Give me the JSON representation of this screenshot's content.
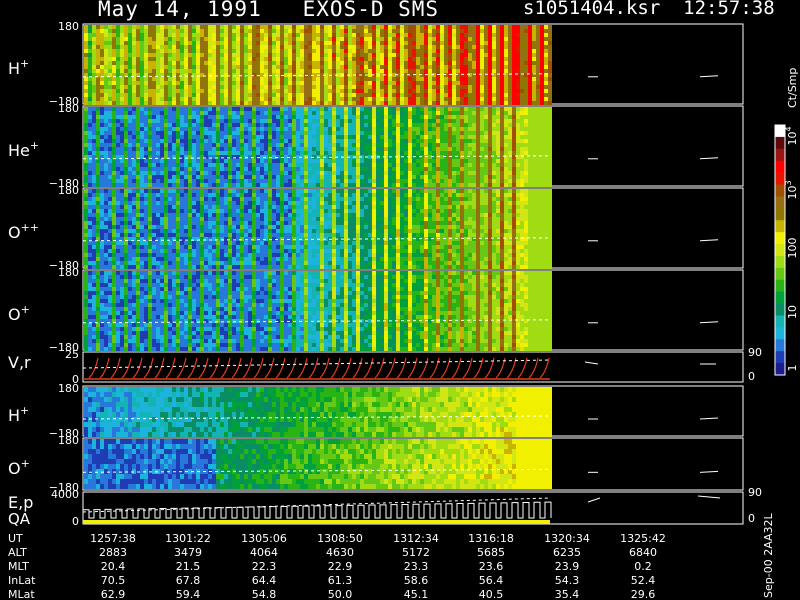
{
  "header": {
    "title": "May 14, 1991   EXOS-D SMS",
    "file_time": "s1051404.ksr  12:57:38"
  },
  "chart_data": {
    "type": "heatmap",
    "panels": [
      {
        "id": "h",
        "label_base": "H",
        "label_sup": "+",
        "y_top": "180",
        "y_bottom": "−180",
        "right_top": "",
        "right_bottom": ""
      },
      {
        "id": "he",
        "label_base": "He",
        "label_sup": "+",
        "y_top": "180",
        "y_bottom": "−180",
        "right_top": "",
        "right_bottom": ""
      },
      {
        "id": "opp",
        "label_base": "O",
        "label_sup": "++",
        "y_top": "180",
        "y_bottom": "−180",
        "right_top": "",
        "right_bottom": ""
      },
      {
        "id": "op",
        "label_base": "O",
        "label_sup": "+",
        "y_top": "180",
        "y_bottom": "−180",
        "right_top": "",
        "right_bottom": ""
      },
      {
        "id": "vr",
        "label_base": "V,r",
        "label_sup": "",
        "y_top": "25",
        "y_bottom": "0",
        "right_top": "90",
        "right_bottom": "0"
      },
      {
        "id": "h2",
        "label_base": "H",
        "label_sup": "+",
        "y_top": "180",
        "y_bottom": "−180",
        "right_top": "",
        "right_bottom": ""
      },
      {
        "id": "o2",
        "label_base": "O",
        "label_sup": "+",
        "y_top": "180",
        "y_bottom": "−180",
        "right_top": "",
        "right_bottom": ""
      },
      {
        "id": "ep",
        "label_base": "E,p",
        "label_sup": "",
        "y_top": "4000",
        "y_bottom": "0",
        "right_top": "90",
        "right_bottom": "0",
        "label2": "QA"
      }
    ],
    "colorbar": {
      "unit": "Ct/Smp",
      "tick_labels": [
        "1",
        "10",
        "100",
        "10",
        "10"
      ],
      "tick_exps": [
        "",
        "",
        "",
        "3",
        "4"
      ],
      "colors": [
        "#1c1c8c",
        "#1e3cb4",
        "#2878dc",
        "#1cb4dc",
        "#14b4b4",
        "#0a8c64",
        "#00a03c",
        "#28b414",
        "#64c814",
        "#a0dc14",
        "#d2e614",
        "#f0f000",
        "#c8b400",
        "#8c7800",
        "#966e14",
        "#a05000",
        "#e61400",
        "#ff0000",
        "#9b1414",
        "#5a0a0a",
        "#ffffff"
      ]
    },
    "x_ticks": [
      "1257:38",
      "1301:22",
      "1305:06",
      "1308:50",
      "1312:34",
      "1316:18",
      "1320:34",
      "1325:42"
    ],
    "orbit_table": [
      {
        "name": "UT",
        "values": [
          "1257:38",
          "1301:22",
          "1305:06",
          "1308:50",
          "1312:34",
          "1316:18",
          "1320:34",
          "1325:42"
        ]
      },
      {
        "name": "ALT",
        "values": [
          "2883",
          "3479",
          "4064",
          "4630",
          "5172",
          "5685",
          "6235",
          "6840"
        ]
      },
      {
        "name": "MLT",
        "values": [
          "20.4",
          "21.5",
          "22.3",
          "22.9",
          "23.3",
          "23.6",
          "23.9",
          "0.2"
        ]
      },
      {
        "name": "InLat",
        "values": [
          "70.5",
          "67.8",
          "64.4",
          "61.3",
          "58.6",
          "56.4",
          "54.3",
          "52.4"
        ]
      },
      {
        "name": "MLat",
        "values": [
          "62.9",
          "59.4",
          "54.8",
          "50.0",
          "45.1",
          "40.5",
          "35.4",
          "29.6"
        ]
      }
    ],
    "footer_note": "Sep-00  2AA32L"
  }
}
